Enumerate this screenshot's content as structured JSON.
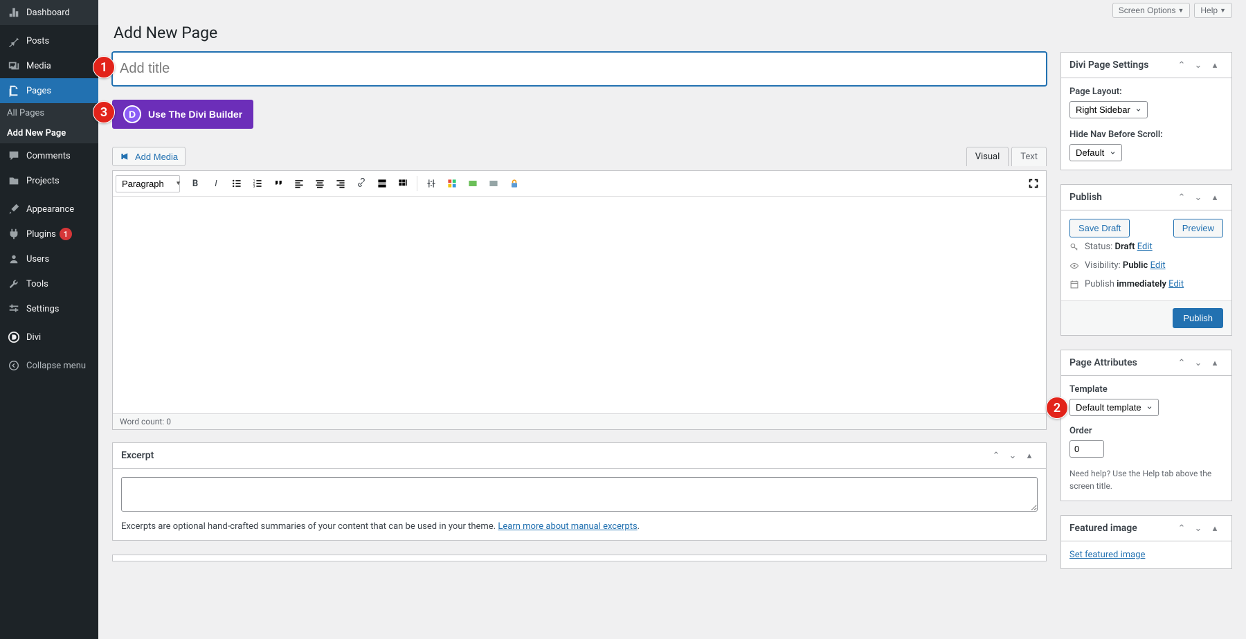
{
  "sidebar": {
    "dashboard": "Dashboard",
    "posts": "Posts",
    "media": "Media",
    "pages": "Pages",
    "all_pages": "All Pages",
    "add_new_page": "Add New Page",
    "comments": "Comments",
    "projects": "Projects",
    "appearance": "Appearance",
    "plugins": "Plugins",
    "plugins_count": "1",
    "users": "Users",
    "tools": "Tools",
    "settings": "Settings",
    "divi": "Divi",
    "collapse": "Collapse menu"
  },
  "top": {
    "screen_options": "Screen Options",
    "help": "Help"
  },
  "page": {
    "title": "Add New Page",
    "title_placeholder": "Add title",
    "divi_builder": "Use The Divi Builder",
    "add_media": "Add Media",
    "tab_visual": "Visual",
    "tab_text": "Text",
    "format": "Paragraph",
    "word_count_label": "Word count: ",
    "word_count": "0"
  },
  "excerpt": {
    "heading": "Excerpt",
    "desc_text": "Excerpts are optional hand-crafted summaries of your content that can be used in your theme. ",
    "desc_link": "Learn more about manual excerpts"
  },
  "divi_settings": {
    "heading": "Divi Page Settings",
    "page_layout_label": "Page Layout:",
    "page_layout_value": "Right Sidebar",
    "hide_nav_label": "Hide Nav Before Scroll:",
    "hide_nav_value": "Default"
  },
  "publish": {
    "heading": "Publish",
    "save_draft": "Save Draft",
    "preview": "Preview",
    "status_label": "Status: ",
    "status_value": "Draft",
    "visibility_label": "Visibility: ",
    "visibility_value": "Public",
    "publish_label": "Publish ",
    "publish_value": "immediately",
    "edit": "Edit",
    "publish_btn": "Publish"
  },
  "attributes": {
    "heading": "Page Attributes",
    "template_label": "Template",
    "template_value": "Default template",
    "order_label": "Order",
    "order_value": "0",
    "help_text": "Need help? Use the Help tab above the screen title."
  },
  "featured": {
    "heading": "Featured image",
    "link": "Set featured image"
  },
  "markers": {
    "m1": "1",
    "m2": "2",
    "m3": "3"
  }
}
